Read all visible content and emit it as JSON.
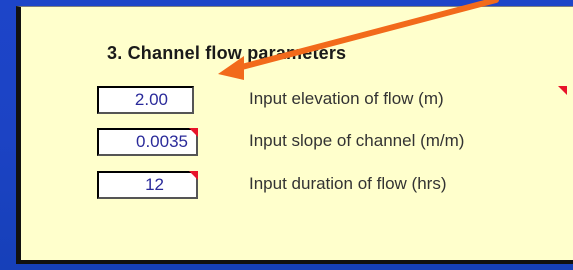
{
  "section": {
    "title": "3. Channel flow parameters"
  },
  "params": [
    {
      "value": "2.00",
      "label": "Input elevation of flow (m)"
    },
    {
      "value": "0.0035",
      "label": "Input slope of channel (m/m)"
    },
    {
      "value": "12",
      "label": "Input duration of flow (hrs)"
    }
  ],
  "colors": {
    "background": "#1d45c9",
    "panel": "#ffffcc",
    "arrow": "#f26a1b",
    "comment_marker": "#e8142a",
    "value_text": "#2a2a9a"
  },
  "icons": {
    "pointer": "arrow-annotation-icon",
    "comment": "comment-indicator-icon"
  }
}
